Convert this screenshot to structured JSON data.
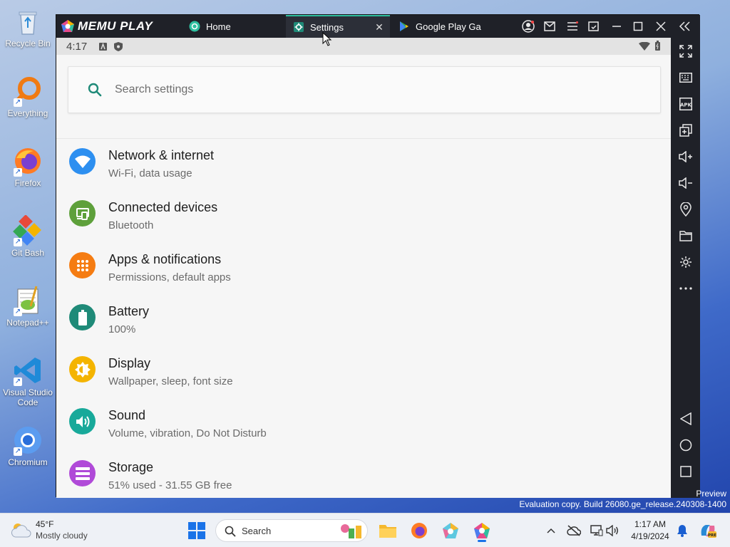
{
  "desktop": {
    "icons": [
      {
        "label": "Recycle Bin"
      },
      {
        "label": "Everything"
      },
      {
        "label": "Firefox"
      },
      {
        "label": "Git Bash"
      },
      {
        "label": "Notepad++"
      },
      {
        "label": "Visual Studio Code"
      },
      {
        "label": "Chromium"
      }
    ]
  },
  "window": {
    "logo_text": "MEMU PLAY",
    "tabs": [
      {
        "label": "Home",
        "icon": "home-tab-icon"
      },
      {
        "label": "Settings",
        "icon": "gear-icon",
        "active": true
      },
      {
        "label": "Google Play Ga",
        "icon": "play-store-icon"
      }
    ],
    "accent": "#2ec0a0"
  },
  "android": {
    "status_time": "4:17",
    "search_placeholder": "Search settings",
    "settings": [
      {
        "title": "Network & internet",
        "subtitle": "Wi-Fi, data usage",
        "color": "#2d8ff0",
        "icon": "wifi-icon"
      },
      {
        "title": "Connected devices",
        "subtitle": "Bluetooth",
        "color": "#5ea03b",
        "icon": "devices-icon"
      },
      {
        "title": "Apps & notifications",
        "subtitle": "Permissions, default apps",
        "color": "#f57c12",
        "icon": "apps-grid-icon"
      },
      {
        "title": "Battery",
        "subtitle": "100%",
        "color": "#1f8a78",
        "icon": "battery-icon"
      },
      {
        "title": "Display",
        "subtitle": "Wallpaper, sleep, font size",
        "color": "#f4b400",
        "icon": "brightness-icon"
      },
      {
        "title": "Sound",
        "subtitle": "Volume, vibration, Do Not Disturb",
        "color": "#18a99a",
        "icon": "volume-icon"
      },
      {
        "title": "Storage",
        "subtitle": "51% used - 31.55 GB free",
        "color": "#b04ad8",
        "icon": "storage-icon"
      }
    ]
  },
  "watermark": {
    "line1": "Preview",
    "line2": "Evaluation copy. Build 26080.ge_release.240308-1400"
  },
  "taskbar": {
    "weather_temp": "45°F",
    "weather_cond": "Mostly cloudy",
    "search_label": "Search",
    "clock_time": "1:17 AM",
    "clock_date": "4/19/2024"
  }
}
